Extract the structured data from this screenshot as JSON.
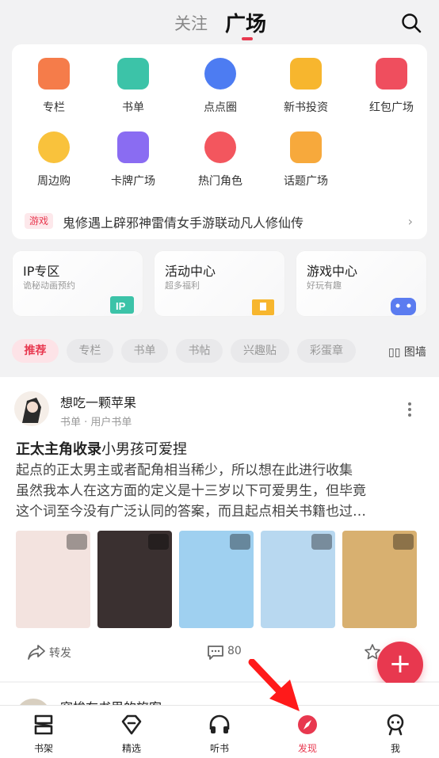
{
  "header": {
    "tab_follow": "关注",
    "tab_square": "广场"
  },
  "grid": [
    {
      "label": "专栏",
      "icon": "column-icon",
      "color": "#f57c4a"
    },
    {
      "label": "书单",
      "icon": "booklist-icon",
      "color": "#3cc3a8"
    },
    {
      "label": "点点圈",
      "icon": "circle-icon",
      "color": "#4d7cf2"
    },
    {
      "label": "新书投资",
      "icon": "invest-icon",
      "color": "#f7b62e"
    },
    {
      "label": "红包广场",
      "icon": "redpacket-icon",
      "color": "#ef4e5e"
    },
    {
      "label": "周边购",
      "icon": "fox-icon",
      "color": "#f9c23c"
    },
    {
      "label": "卡牌广场",
      "icon": "card-icon",
      "color": "#8a6cf2"
    },
    {
      "label": "热门角色",
      "icon": "role-icon",
      "color": "#f3565e"
    },
    {
      "label": "话题广场",
      "icon": "topic-icon",
      "color": "#f7a93c"
    }
  ],
  "promo": {
    "tag": "游戏",
    "text": "鬼修遇上辟邪神雷倩女手游联动凡人修仙传"
  },
  "features": [
    {
      "title": "IP专区",
      "subtitle": "诡秘动画预约"
    },
    {
      "title": "活动中心",
      "subtitle": "超多福利"
    },
    {
      "title": "游戏中心",
      "subtitle": "好玩有趣"
    }
  ],
  "filters": [
    "推荐",
    "专栏",
    "书单",
    "书帖",
    "兴趣贴",
    "彩蛋章"
  ],
  "wall_label": "图墙",
  "post": {
    "author": "想吃一颗苹果",
    "meta": "书单 · 用户书单",
    "title_bold": "正太主角收录",
    "title_rest": "小男孩可爱捏",
    "body": [
      "起点的正太男主或者配角相当稀少，所以想在此进行收集",
      "虽然我本人在这方面的定义是十三岁以下可爱男生，但毕竟",
      "这个词至今没有广泛认同的答案，而且起点相关书籍也过…"
    ],
    "book_colors": [
      "#f3e3df",
      "#3a3030",
      "#9fd0f0",
      "#b8d8f0",
      "#d8b070"
    ],
    "share_label": "转发",
    "comment_count": "80"
  },
  "post2": {
    "title": "穿梭在书里的旅客"
  },
  "bottom_nav": [
    {
      "label": "书架",
      "icon": "bookshelf-icon"
    },
    {
      "label": "精选",
      "icon": "diamond-icon"
    },
    {
      "label": "听书",
      "icon": "headphones-icon"
    },
    {
      "label": "发现",
      "icon": "compass-icon",
      "active": true
    },
    {
      "label": "我",
      "icon": "profile-icon"
    }
  ],
  "colors": {
    "accent": "#e8384f"
  }
}
